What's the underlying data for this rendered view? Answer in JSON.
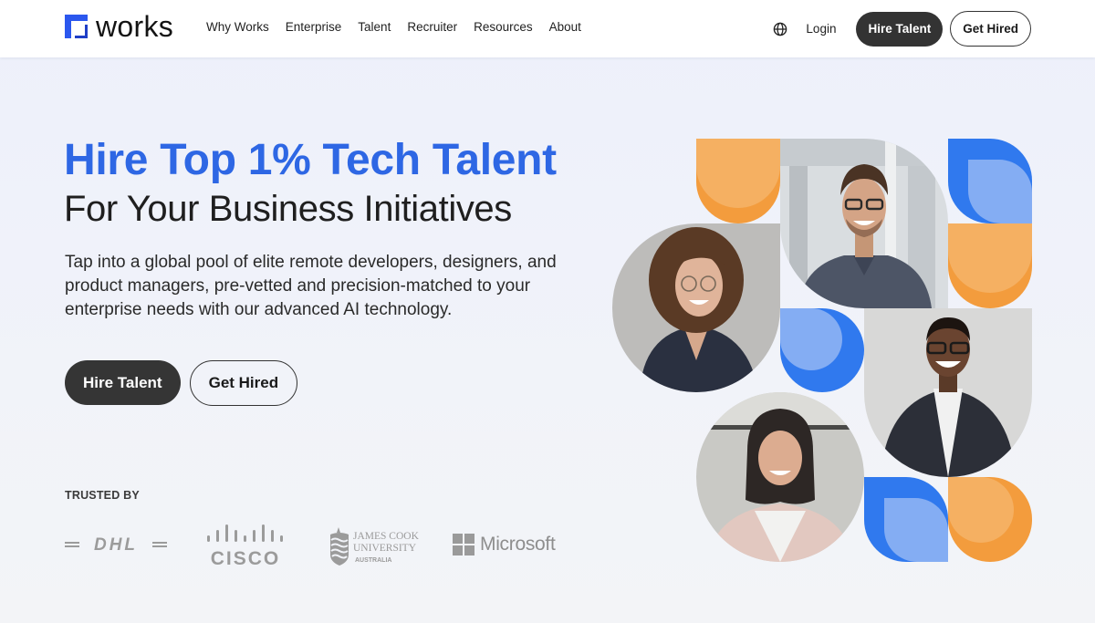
{
  "header": {
    "logo_text": "works",
    "nav": [
      "Why Works",
      "Enterprise",
      "Talent",
      "Recruiter",
      "Resources",
      "About"
    ],
    "language_icon": "globe-icon",
    "login_label": "Login",
    "hire_talent_label": "Hire Talent",
    "get_hired_label": "Get Hired"
  },
  "hero": {
    "title": "Hire Top 1% Tech Talent",
    "subtitle": "For Your Business Initiatives",
    "description": "Tap into a global pool of elite remote developers, designers, and product managers, pre-vetted and precision-matched to your enterprise needs with our advanced AI technology.",
    "primary_cta": "Hire Talent",
    "secondary_cta": "Get Hired"
  },
  "trusted": {
    "label": "TRUSTED BY",
    "logos": [
      {
        "name": "DHL",
        "text": "DHL"
      },
      {
        "name": "Cisco",
        "text": "CISCO"
      },
      {
        "name": "James Cook University",
        "line1": "JAMES COOK",
        "line2": "UNIVERSITY",
        "line3": "AUSTRALIA"
      },
      {
        "name": "Microsoft",
        "text": "Microsoft"
      }
    ]
  },
  "collage": {
    "photos": [
      {
        "name": "curly-haired-woman-with-glasses"
      },
      {
        "name": "man-with-glasses-blue-shirt"
      },
      {
        "name": "man-with-glasses-suit"
      },
      {
        "name": "woman-with-dark-hair-pink-blazer"
      }
    ],
    "colors": {
      "orange": "#f39c3d",
      "orange_light": "#f5b062",
      "blue": "#3079ee",
      "blue_light": "#84adf3"
    }
  },
  "theme": {
    "accent": "#2e67e4",
    "button_dark": "#353535",
    "logo_blue": "#2b57ee"
  }
}
